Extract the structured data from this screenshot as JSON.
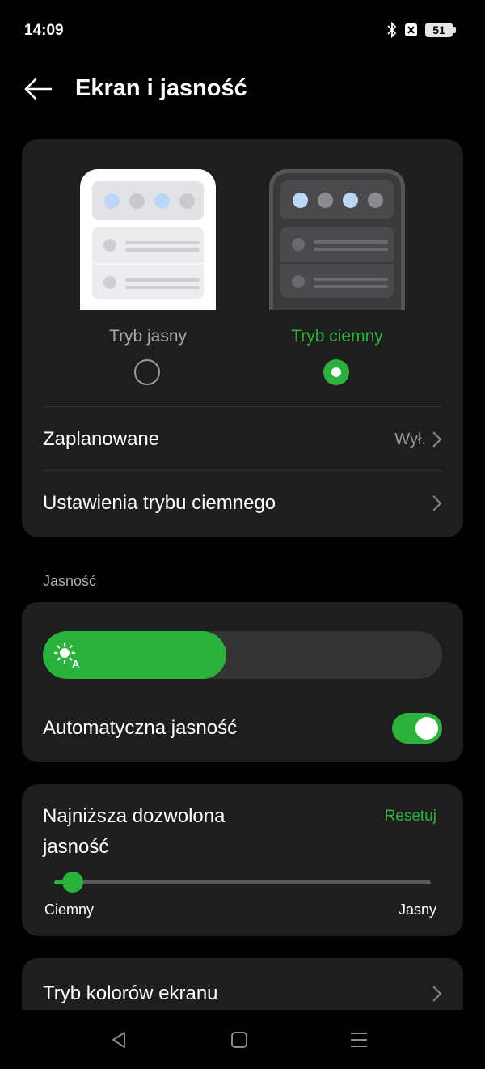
{
  "status": {
    "time": "14:09",
    "battery": "51"
  },
  "header": {
    "title": "Ekran i jasność"
  },
  "theme": {
    "light_label": "Tryb jasny",
    "dark_label": "Tryb ciemny",
    "selected": "dark"
  },
  "scheduled": {
    "label": "Zaplanowane",
    "value": "Wył."
  },
  "dark_settings": {
    "label": "Ustawienia trybu ciemnego"
  },
  "brightness": {
    "section_label": "Jasność",
    "level": 0.46,
    "auto_label": "Automatyczna jasność",
    "auto_enabled": true
  },
  "min_brightness": {
    "title": "Najniższa dozwolona jasność",
    "reset_label": "Resetuj",
    "left_label": "Ciemny",
    "right_label": "Jasny",
    "level": 0.05
  },
  "color_mode": {
    "label": "Tryb kolorów ekranu"
  },
  "colors": {
    "accent": "#2ab23d",
    "card": "#1e1e1e",
    "background": "#000000"
  }
}
